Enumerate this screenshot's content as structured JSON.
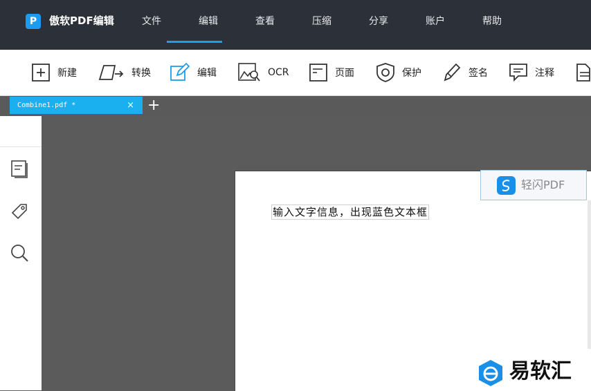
{
  "app": {
    "logo_letter": "P",
    "title": "傲软PDF编辑"
  },
  "menu": [
    "文件",
    "编辑",
    "查看",
    "压缩",
    "分享",
    "账户",
    "帮助"
  ],
  "toolbar": {
    "items": [
      {
        "label": "新建",
        "icon": "plus-square-icon"
      },
      {
        "label": "转换",
        "icon": "convert-icon"
      },
      {
        "label": "编辑",
        "icon": "edit-pen-icon",
        "active": true
      },
      {
        "label": "OCR",
        "icon": "ocr-image-search-icon"
      },
      {
        "label": "页面",
        "icon": "page-icon"
      },
      {
        "label": "保护",
        "icon": "shield-icon"
      },
      {
        "label": "签名",
        "icon": "sign-pen-icon"
      },
      {
        "label": "注释",
        "icon": "comment-icon"
      }
    ],
    "accent": "#1aa0e6"
  },
  "tabs": {
    "active_name": "Combine1.pdf *",
    "close_glyph": "×",
    "add_glyph": "+"
  },
  "sidebar": {
    "icons": [
      "pages-thumbnail-icon",
      "tag-icon",
      "search-icon"
    ]
  },
  "document": {
    "text_box": "输入文字信息，出现蓝色文本框"
  },
  "watermarks": {
    "qingshan": "轻闪PDF",
    "yiruanhui": "易软汇"
  }
}
